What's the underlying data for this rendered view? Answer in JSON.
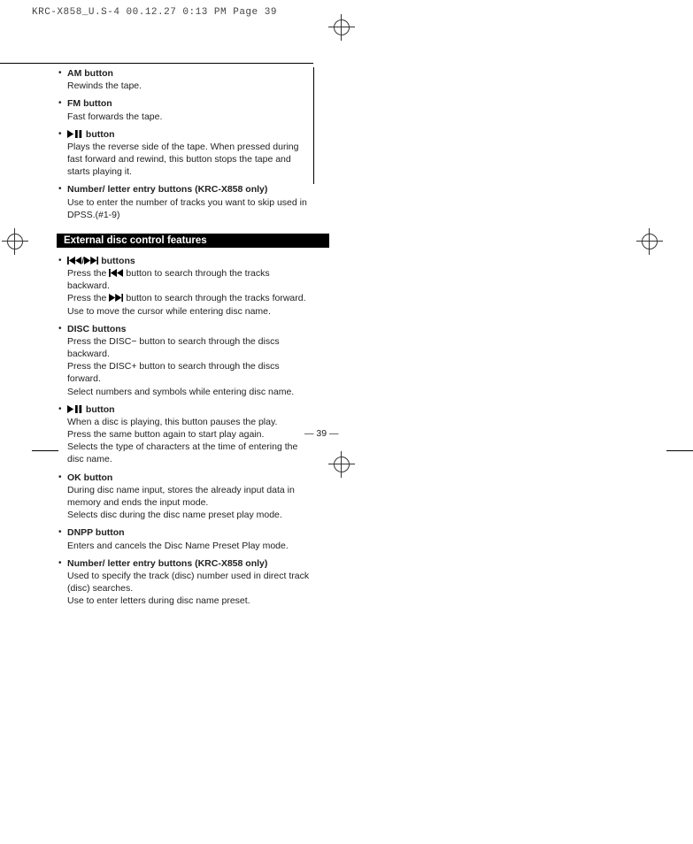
{
  "header": "KRC-X858_U.S-4  00.12.27  0:13 PM  Page 39",
  "section1": {
    "items": [
      {
        "title": "AM button",
        "desc": [
          "Rewinds the tape."
        ]
      },
      {
        "title": "FM button",
        "desc": [
          "Fast forwards the tape."
        ]
      },
      {
        "title_prefix": "",
        "icon": "play-pause-icon",
        "title": " button",
        "desc": [
          "Plays the reverse side of the tape. When pressed during fast forward and rewind, this button stops the tape and starts playing it."
        ]
      },
      {
        "title": "Number/ letter entry buttons (KRC-X858 only)",
        "desc": [
          "Use to enter the number of tracks you want to skip used in DPSS.(#1-9)"
        ]
      }
    ]
  },
  "section_bar": "External disc control features",
  "section2": {
    "items": [
      {
        "icon_seq": "prev-next-icons",
        "title": " buttons",
        "desc_lines": [
          {
            "pre": "Press the ",
            "icon": "prev-icon",
            "post": " button to search through the tracks backward."
          },
          {
            "pre": "Press the ",
            "icon": "next-icon",
            "post": " button to search through the tracks forward."
          },
          {
            "text": "Use to move the cursor while entering disc name."
          }
        ]
      },
      {
        "title": "DISC buttons",
        "desc_lines": [
          {
            "text": "Press the DISC− button to search through the discs backward."
          },
          {
            "text": "Press the DISC+ button to search through the discs forward."
          },
          {
            "text": "Select numbers and symbols while entering disc name."
          }
        ]
      },
      {
        "icon": "play-pause-icon",
        "title": " button",
        "desc_lines": [
          {
            "text": "When a disc is playing, this button pauses the play."
          },
          {
            "text": "Press the same button again to start play again."
          },
          {
            "text": "Selects the type of characters at the time of entering the disc name."
          }
        ]
      },
      {
        "title": "OK button",
        "desc_lines": [
          {
            "text": "During disc name input, stores the already input data in memory and ends the input mode."
          },
          {
            "text": "Selects disc during the disc name preset play mode."
          }
        ]
      },
      {
        "title": "DNPP button",
        "desc_lines": [
          {
            "text": "Enters and cancels the Disc Name Preset Play mode."
          }
        ]
      },
      {
        "title": "Number/ letter entry buttons (KRC-X858 only)",
        "desc_lines": [
          {
            "text": "Used to specify the track (disc) number used in direct track (disc) searches."
          },
          {
            "text": "Use to enter letters during disc name preset."
          }
        ]
      }
    ]
  },
  "page_number": "39"
}
